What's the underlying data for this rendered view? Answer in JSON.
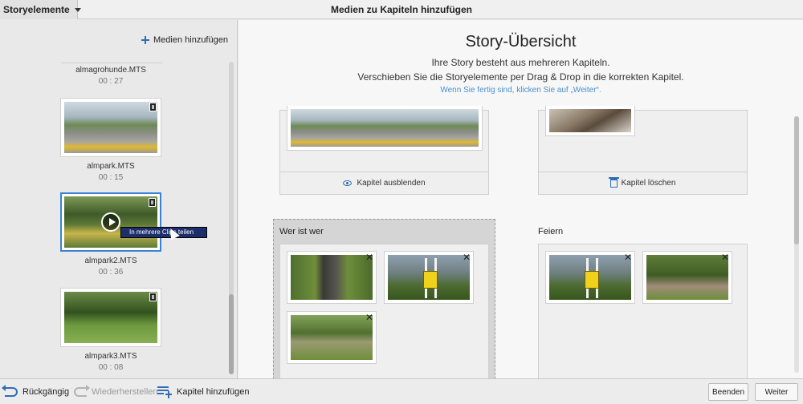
{
  "topbar": {
    "dropdown_label": "Storyelemente",
    "title": "Medien zu Kapiteln hinzufügen"
  },
  "left": {
    "add_media_label": "Medien hinzufügen",
    "clips": [
      {
        "name": "almagrohunde.MTS",
        "duration": "00 : 27"
      },
      {
        "name": "almpark.MTS",
        "duration": "00 : 15"
      },
      {
        "name": "almpark2.MTS",
        "duration": "00 : 36"
      },
      {
        "name": "almpark3.MTS",
        "duration": "00 : 08"
      }
    ],
    "context_menu_item": "In mehrere Clips teilen"
  },
  "main": {
    "title": "Story-Übersicht",
    "subtitle1": "Ihre Story besteht aus mehreren Kapiteln.",
    "subtitle2": "Verschieben Sie die Storyelemente per Drag & Drop in die korrekten Kapitel.",
    "hint": "Wenn Sie fertig sind, klicken Sie auf „Weiter“.",
    "hide_chapter_label": "Kapitel ausblenden",
    "delete_chapter_label": "Kapitel löschen",
    "chapters": [
      {
        "title": "Wer ist wer"
      },
      {
        "title": "Feiern"
      }
    ],
    "remove_glyph": "✕"
  },
  "bottombar": {
    "undo_label": "Rückgängig",
    "redo_label": "Wiederherstellen",
    "add_chapter_label": "Kapitel hinzufügen",
    "finish_label": "Beenden",
    "next_label": "Weiter"
  }
}
